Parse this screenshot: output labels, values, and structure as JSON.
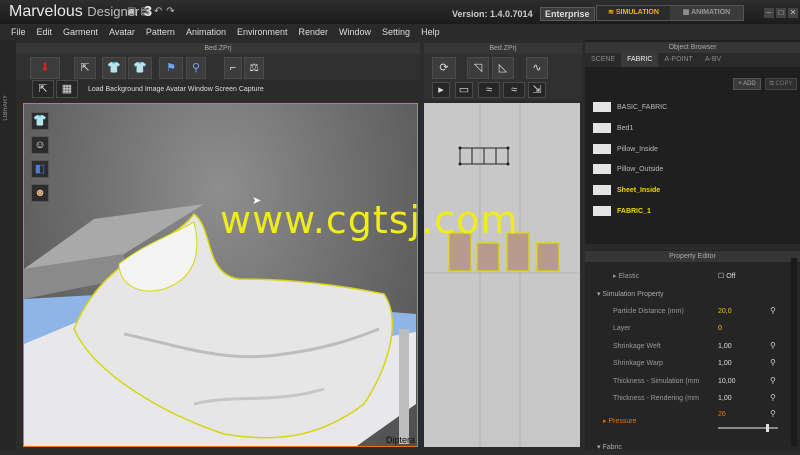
{
  "titlebar": {
    "app_name": "Marvelous",
    "app_name_2": "Designer",
    "app_version_num": "3",
    "version_label": "Version:",
    "version_value": "1.4.0.7014",
    "edition": "Enterprise",
    "modes": [
      {
        "label": "SIMULATION",
        "active": true
      },
      {
        "label": "ANIMATION",
        "active": false
      }
    ]
  },
  "menu": [
    "File",
    "Edit",
    "Garment",
    "Avatar",
    "Pattern",
    "Animation",
    "Environment",
    "Render",
    "Window",
    "Setting",
    "Help"
  ],
  "library_label": "LIBRARY",
  "panels": {
    "view3d_title": "Bed.ZPrj",
    "view2d_title": "Bed.ZPrj",
    "browser_title": "Object Browser",
    "prop_title": "Property Editor"
  },
  "toolbar3d": {
    "secondary_tools": "Load Background Image Avatar Window Screen Capture"
  },
  "viewport": {
    "label": "Diptera"
  },
  "watermark": "www.cgtsj.com",
  "browser": {
    "tabs": [
      "SCENE",
      "FABRIC",
      "A-POINT",
      "A-BV"
    ],
    "active_tab": "FABRIC",
    "add_label": "ADD",
    "copy_label": "COPY",
    "fabrics": [
      {
        "name": "BASIC_FABRIC",
        "highlight": false
      },
      {
        "name": "Bed1",
        "highlight": false
      },
      {
        "name": "Pillow_Inside",
        "highlight": false
      },
      {
        "name": "Pillow_Outside",
        "highlight": false
      },
      {
        "name": "Sheet_Inside",
        "highlight": true
      },
      {
        "name": "FABRIC_1",
        "highlight": true
      }
    ]
  },
  "properties": {
    "elastic_label": "Elastic",
    "elastic_value": "Off",
    "sim_section": "Simulation Property",
    "rows": [
      {
        "label": "Particle Distance (mm)",
        "value": "20,0",
        "color": "yellow"
      },
      {
        "label": "Layer",
        "value": "0",
        "color": "yellow"
      },
      {
        "label": "Shrinkage Weft",
        "value": "1,00",
        "color": "white"
      },
      {
        "label": "Shrinkage Warp",
        "value": "1,00",
        "color": "white"
      },
      {
        "label": "Thickness - Simulation (mm",
        "value": "10,00",
        "color": "white"
      },
      {
        "label": "Thickness - Rendering (mm",
        "value": "1,00",
        "color": "white"
      }
    ],
    "pressure_label": "Pressure",
    "pressure_value": "26",
    "pressure_level": 0.85,
    "fabric_section": "Fabric"
  },
  "colors": {
    "accent": "#f5b400",
    "viewport_border": "#e07b13",
    "highlight_text": "#f2d400",
    "watermark": "#f0ec18",
    "pressure": "#e8700a"
  }
}
